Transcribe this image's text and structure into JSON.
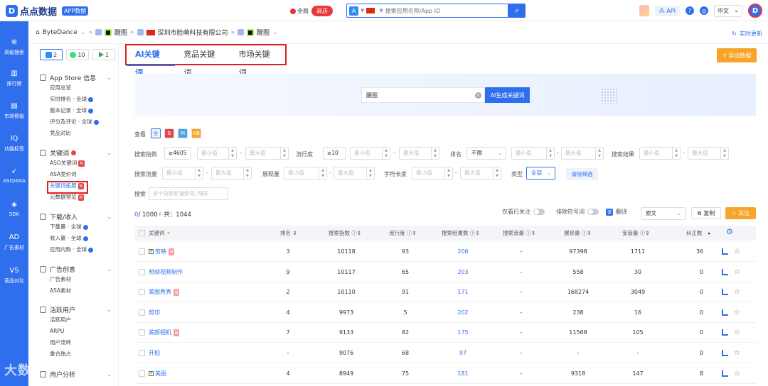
{
  "brand": {
    "name": "点点数据",
    "badge": "APP数据"
  },
  "region": {
    "global_label": "全局",
    "store_label": "商店"
  },
  "search": {
    "placeholder": "搜索应用名称/App ID"
  },
  "topbar": {
    "api_label": "API",
    "language": "中文"
  },
  "rail": [
    "高级搜索",
    "排行榜",
    "市场情报",
    "功能标签",
    "ASO/ASA",
    "SDK",
    "广告素材",
    "竞品对比"
  ],
  "breadcrumb": {
    "developer": "ByteDance",
    "app1": "醒图",
    "company": "深圳市脸萌科技有限公司",
    "app2": "醒图",
    "realtime": "实时更新"
  },
  "platform_tabs": [
    {
      "label": "2"
    },
    {
      "label": "10"
    },
    {
      "label": "1"
    }
  ],
  "sidebar": [
    {
      "title": "App Store 信息",
      "items": [
        "应用总览",
        "实时排名 · 全球",
        "版本记录 · 全球",
        "评分及评论 · 全球",
        "竞品对比"
      ]
    },
    {
      "title": "关键词",
      "items": [
        "ASO关键词",
        "ASA竞价词",
        "关键词拓展",
        "元数据预览"
      ]
    },
    {
      "title": "下载/收入",
      "items": [
        "下载量 · 全球",
        "收入量 · 全球",
        "应用内购 · 全球"
      ]
    },
    {
      "title": "广告创意",
      "items": [
        "广告素材",
        "ASA素材"
      ]
    },
    {
      "title": "活跃用户",
      "items": [
        "活跃用户",
        "ARPU",
        "用户流转",
        "重合独占"
      ]
    },
    {
      "title": "用户分析",
      "items": []
    }
  ],
  "tabs": [
    "AI关键词",
    "竞品关键词",
    "市场关键词"
  ],
  "export_label": "导出数据",
  "ai_search": {
    "value": "醒图",
    "button": "AI生成关键词"
  },
  "filters": {
    "view_label": "查看",
    "view_options": [
      "全",
      "B",
      "M",
      "AB"
    ],
    "search_index_label": "搜索指数",
    "search_index_value": "≥4605",
    "popularity_label": "流行度",
    "popularity_value": "≥10",
    "rank_label": "排名",
    "rank_value": "不限",
    "results_label": "搜索结果",
    "traffic_label": "搜索流量",
    "impressions_label": "展现量",
    "length_label": "字符长度",
    "type_label": "类型",
    "type_value": "全部",
    "clear_label": "清除筛选",
    "search_label": "搜索",
    "search_placeholder": "多个词请用'搜索词','隔开",
    "min_ph": "最小值",
    "max_ph": "最大值"
  },
  "summary": {
    "selected": "0",
    "total_prefix": "/ 1000",
    "count_label": "共：1044"
  },
  "toolbar": {
    "only_followed": "仅看已关注",
    "exclude_symbols": "排除符号词",
    "translate": "翻译",
    "lang": "原文",
    "copy": "复制",
    "follow": "关注"
  },
  "table": {
    "headers": [
      "关键词",
      "排名",
      "搜索指数",
      "流行度",
      "搜索结果数",
      "搜索流量",
      "展现量",
      "安装量",
      "纠正数"
    ],
    "rows": [
      {
        "kw": "剪映",
        "rank": "3",
        "index": "10118",
        "pop": "93",
        "results": "206",
        "traffic": "-",
        "impr": "97398",
        "installs": "1711",
        "fix": "36"
      },
      {
        "kw": "剪映视频制作",
        "rank": "9",
        "index": "10117",
        "pop": "65",
        "results": "203",
        "traffic": "-",
        "impr": "558",
        "installs": "30",
        "fix": "0"
      },
      {
        "kw": "美图秀秀",
        "rank": "2",
        "index": "10110",
        "pop": "91",
        "results": "171",
        "traffic": "-",
        "impr": "168274",
        "installs": "3049",
        "fix": "0"
      },
      {
        "kw": "剪印",
        "rank": "4",
        "index": "9973",
        "pop": "5",
        "results": "202",
        "traffic": "-",
        "impr": "238",
        "installs": "16",
        "fix": "0"
      },
      {
        "kw": "美颜相机",
        "rank": "7",
        "index": "9133",
        "pop": "82",
        "results": "175",
        "traffic": "-",
        "impr": "11568",
        "installs": "105",
        "fix": "0"
      },
      {
        "kw": "开拍",
        "rank": "-",
        "index": "9076",
        "pop": "68",
        "results": "97",
        "traffic": "-",
        "impr": "-",
        "installs": "-",
        "fix": "0"
      },
      {
        "kw": "美图",
        "rank": "4",
        "index": "8949",
        "pop": "75",
        "results": "181",
        "traffic": "-",
        "impr": "9318",
        "installs": "147",
        "fix": "8"
      }
    ]
  },
  "watermark": "大数跨境"
}
